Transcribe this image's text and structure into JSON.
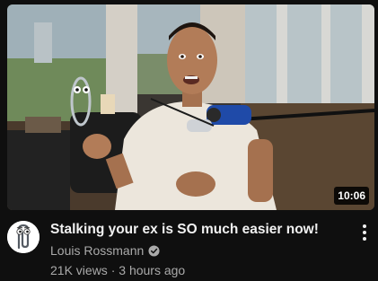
{
  "video": {
    "title": "Stalking your ex is SO much easier now!",
    "duration": "10:06",
    "channel": "Louis Rossmann",
    "views": "21K views",
    "separator": "·",
    "age": "3 hours ago",
    "verified_icon": "check-circle-icon",
    "menu_icon": "more-vertical-icon"
  },
  "colors": {
    "background": "#0f0f0f",
    "title": "#f1f1f1",
    "secondary_text": "#aaaaaa",
    "duration_badge": "#000000"
  }
}
